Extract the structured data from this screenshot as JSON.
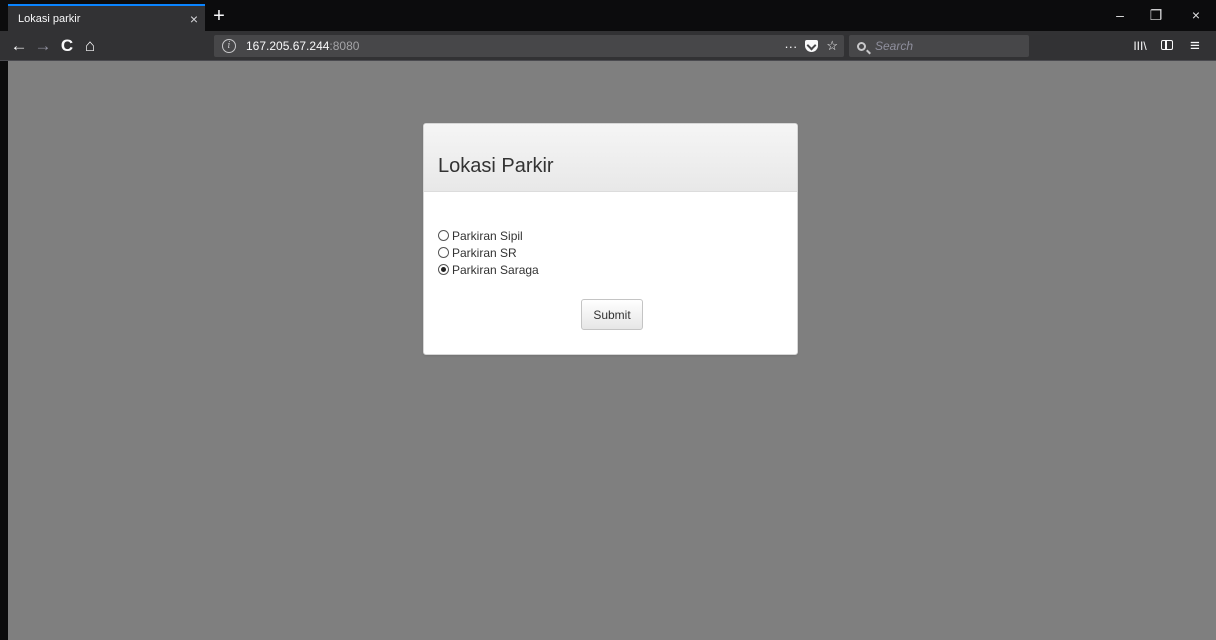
{
  "browser": {
    "tab": {
      "title": "Lokasi parkir",
      "close": "×"
    },
    "new_tab": "+",
    "window_controls": {
      "minimize": "–",
      "restore": "❐",
      "close": "×"
    },
    "nav": {
      "back": "←",
      "forward": "→",
      "reload": "C",
      "home": "⌂"
    },
    "url": {
      "host": "167.205.67.244",
      "port": ":8080"
    },
    "url_actions": {
      "more": "···",
      "bookmark": "☆"
    },
    "search": {
      "placeholder": "Search"
    },
    "toolbar": {
      "library": "III\\",
      "menu": "≡"
    }
  },
  "panel": {
    "title": "Lokasi Parkir",
    "options": [
      {
        "label": "Parkiran Sipil",
        "checked": false
      },
      {
        "label": "Parkiran SR",
        "checked": false
      },
      {
        "label": "Parkiran Saraga",
        "checked": true
      }
    ],
    "submit_label": "Submit"
  },
  "colors": {
    "page_background": "#7f7f7f",
    "chrome_dark": "#0c0c0d",
    "toolbar": "#323234",
    "tab_accent": "#0a84ff"
  }
}
